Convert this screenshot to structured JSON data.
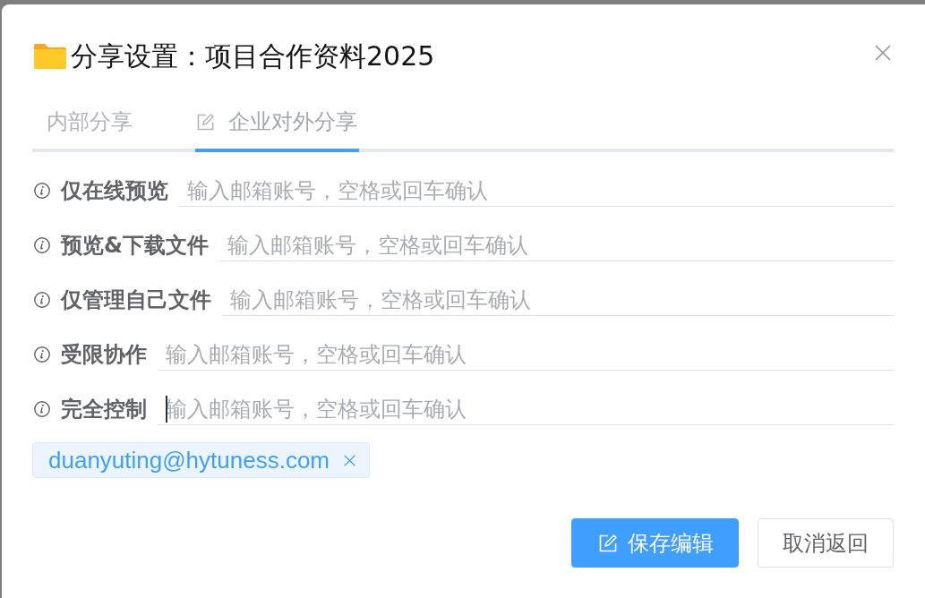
{
  "dialog": {
    "title": "分享设置：项目合作资料2025"
  },
  "tabs": [
    {
      "label": "内部分享",
      "selected": false,
      "kind": "plain"
    },
    {
      "label": "企业对外分享",
      "selected": true,
      "kind": "with-icon"
    }
  ],
  "permissions": [
    {
      "label": "仅在线预览",
      "placeholder": "输入邮箱账号，空格或回车确认",
      "focused": false
    },
    {
      "label": "预览&下载文件",
      "placeholder": "输入邮箱账号，空格或回车确认",
      "focused": false
    },
    {
      "label": "仅管理自己文件",
      "placeholder": "输入邮箱账号，空格或回车确认",
      "focused": false
    },
    {
      "label": "受限协作",
      "placeholder": "输入邮箱账号，空格或回车确认",
      "focused": false
    },
    {
      "label": "完全控制",
      "placeholder": "输入邮箱账号，空格或回车确认",
      "focused": true
    }
  ],
  "tags": [
    {
      "label": "duanyuting@hytuness.com"
    }
  ],
  "buttons": [
    {
      "label": "保存编辑",
      "kind": "primary"
    },
    {
      "label": "取消返回",
      "kind": "default"
    }
  ]
}
